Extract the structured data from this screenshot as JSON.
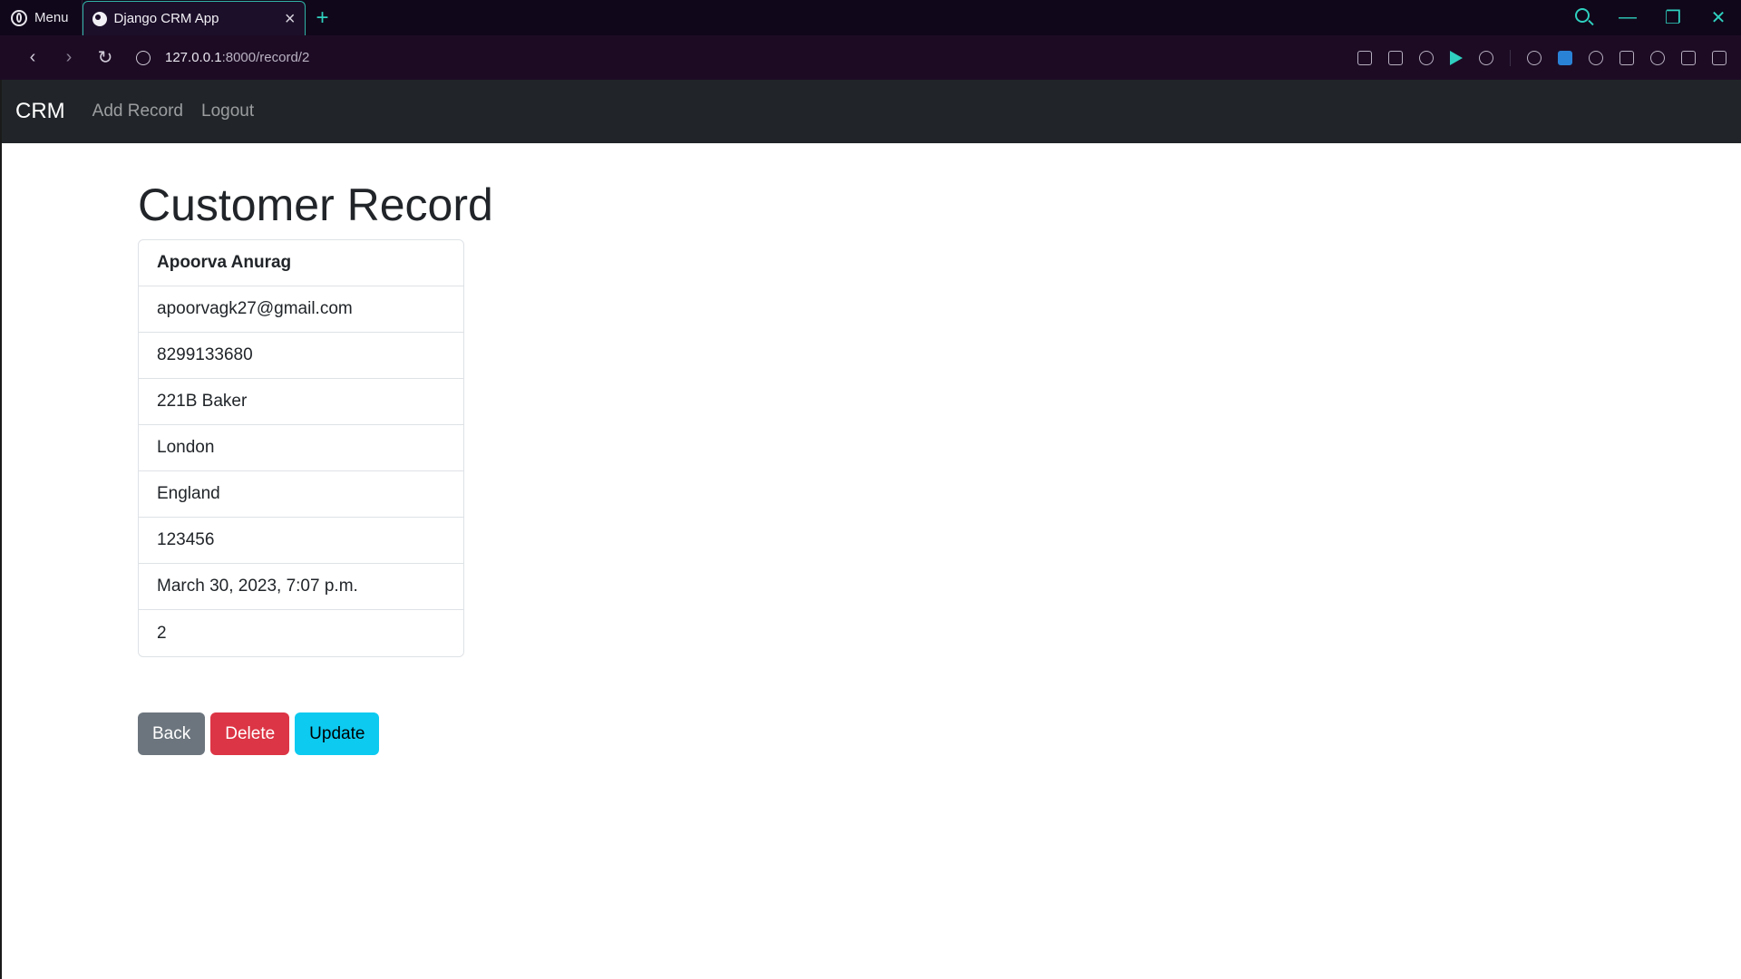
{
  "browser": {
    "menu_label": "Menu",
    "tab_title": "Django CRM App",
    "new_tab_symbol": "+",
    "close_symbol": "×",
    "url_host": "127.0.0.1",
    "url_rest": ":8000/record/2",
    "accent_color": "#2fd0bf"
  },
  "navbar": {
    "brand": "CRM",
    "links": [
      "Add Record",
      "Logout"
    ]
  },
  "main": {
    "title": "Customer Record",
    "record": {
      "name": "Apoorva Anurag",
      "email": "apoorvagk27@gmail.com",
      "phone": "8299133680",
      "address": "221B Baker",
      "city": "London",
      "state": "England",
      "zipcode": "123456",
      "created_at": "March 30, 2023, 7:07 p.m.",
      "id": "2"
    },
    "buttons": {
      "back": "Back",
      "delete": "Delete",
      "update": "Update"
    }
  }
}
